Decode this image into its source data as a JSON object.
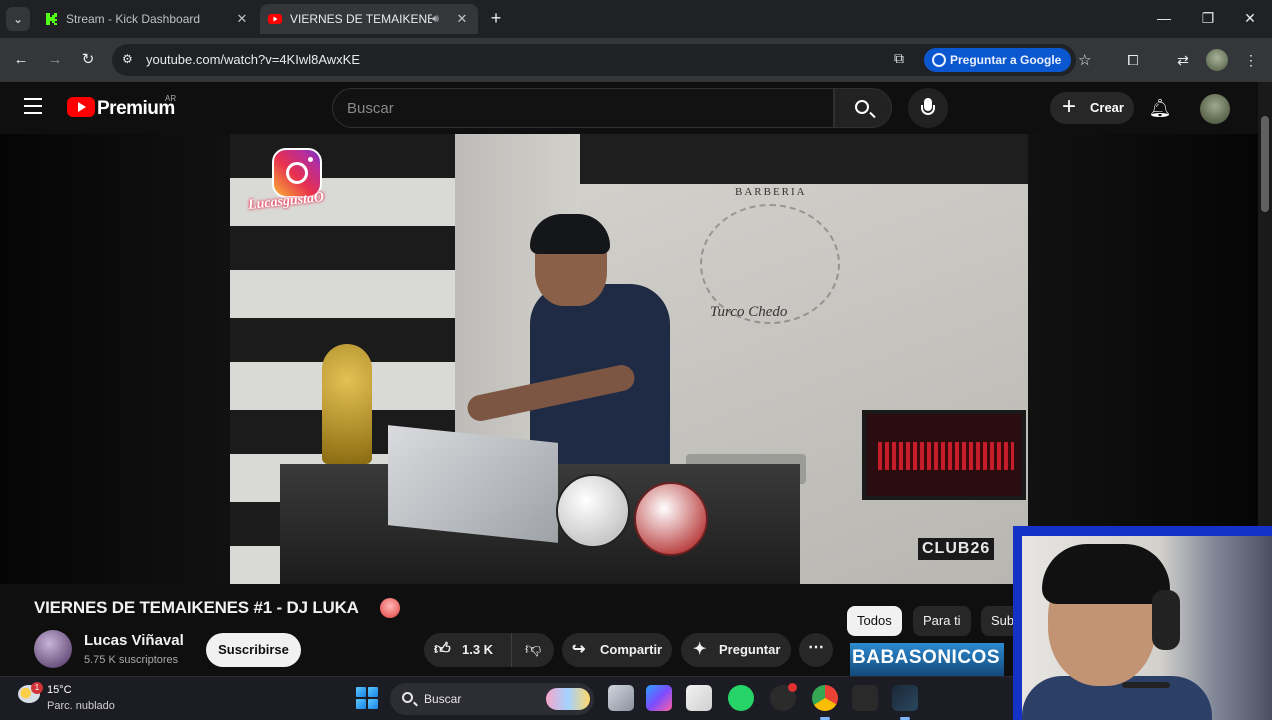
{
  "browser": {
    "tabs": [
      {
        "title": "Stream - Kick Dashboard",
        "favicon": "kick-icon",
        "active": false
      },
      {
        "title": "VIERNES DE TEMAIKENES #",
        "favicon": "youtube-icon",
        "active": true,
        "audio": true
      }
    ],
    "url": "youtube.com/watch?v=4KIwl8AwxKE",
    "ask_google_label": "Preguntar a Google"
  },
  "youtube": {
    "brand": "Premium",
    "region": "AR",
    "search_placeholder": "Buscar",
    "create_label": "Crear"
  },
  "video": {
    "overlay_handle": "LucasgustaO",
    "overlay_sign_top": "BARBERIA",
    "overlay_sign_script": "Turco Chedo",
    "overlay_logo": "CLUB26",
    "title": "VIERNES DE TEMAIKENES #1 - DJ LUKA",
    "channel": "Lucas Viñaval",
    "subscribers": "5.75 K suscriptores",
    "subscribe_label": "Suscribirse",
    "likes": "1.3 K",
    "share_label": "Compartir",
    "ask_label": "Preguntar"
  },
  "sidebar": {
    "chips": [
      "Todos",
      "Para ti",
      "Sub"
    ],
    "recommended_thumb_text": "BABASONICOS"
  },
  "taskbar": {
    "temperature": "15°C",
    "weather": "Parc. nublado",
    "weather_badge": "1",
    "search_label": "Buscar"
  },
  "colors": {
    "youtube_red": "#ff0000",
    "accent_blue": "#0b57d0",
    "webcam_border": "#1432c6",
    "page_bg": "#0f0f0f"
  }
}
